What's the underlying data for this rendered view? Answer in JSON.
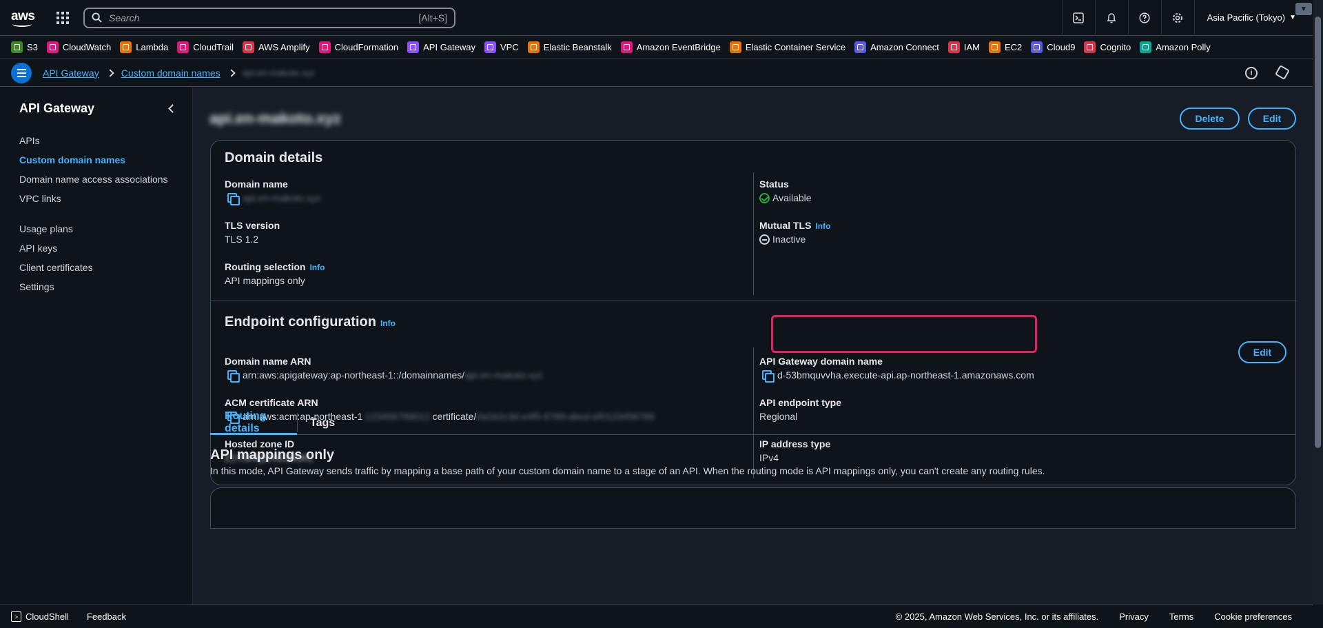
{
  "topnav": {
    "logo": "aws",
    "search_placeholder": "Search",
    "search_hint": "[Alt+S]",
    "region": "Asia Pacific (Tokyo)",
    "icons": [
      "cloudshell-icon",
      "bell-icon",
      "help-icon",
      "gear-icon"
    ]
  },
  "favorites": [
    {
      "label": "S3",
      "color": "#3f8624"
    },
    {
      "label": "CloudWatch",
      "color": "#e7157b"
    },
    {
      "label": "Lambda",
      "color": "#ed7100"
    },
    {
      "label": "CloudTrail",
      "color": "#e7157b"
    },
    {
      "label": "AWS Amplify",
      "color": "#dd344c"
    },
    {
      "label": "CloudFormation",
      "color": "#e7157b"
    },
    {
      "label": "API Gateway",
      "color": "#8c4fff"
    },
    {
      "label": "VPC",
      "color": "#8c4fff"
    },
    {
      "label": "Elastic Beanstalk",
      "color": "#ed7100"
    },
    {
      "label": "Amazon EventBridge",
      "color": "#e7157b"
    },
    {
      "label": "Elastic Container Service",
      "color": "#ed7100"
    },
    {
      "label": "Amazon Connect",
      "color": "#5a5ae6"
    },
    {
      "label": "IAM",
      "color": "#dd344c"
    },
    {
      "label": "EC2",
      "color": "#ed7100"
    },
    {
      "label": "Cloud9",
      "color": "#5a5ae6"
    },
    {
      "label": "Cognito",
      "color": "#dd344c"
    },
    {
      "label": "Amazon Polly",
      "color": "#01a88d"
    }
  ],
  "breadcrumb": {
    "items": [
      "API Gateway",
      "Custom domain names"
    ],
    "current": "api.en-makoto.xyz"
  },
  "sidebar": {
    "title": "API Gateway",
    "group1": [
      "APIs",
      "Custom domain names",
      "Domain name access associations",
      "VPC links"
    ],
    "group2": [
      "Usage plans",
      "API keys",
      "Client certificates",
      "Settings"
    ]
  },
  "page": {
    "title": "api.en-makoto.xyz",
    "delete_label": "Delete",
    "edit_label": "Edit"
  },
  "domain_details": {
    "title": "Domain details",
    "domain_name_label": "Domain name",
    "domain_name_value": "api.en-makoto.xyz",
    "tls_label": "TLS version",
    "tls_value": "TLS 1.2",
    "routing_label": "Routing selection",
    "routing_value": "API mappings only",
    "status_label": "Status",
    "status_value": "Available",
    "mtls_label": "Mutual TLS",
    "mtls_value": "Inactive",
    "info": "Info"
  },
  "endpoint": {
    "title": "Endpoint configuration",
    "info": "Info",
    "edit_label": "Edit",
    "arn_label": "Domain name ARN",
    "arn_value": "arn:aws:apigateway:ap-northeast-1::/domainnames/",
    "arn_hidden": "api.en-makoto.xyz",
    "acm_label": "ACM certificate ARN",
    "acm_value_prefix": "arn:aws:acm:ap-northeast-1",
    "acm_hidden_account": ":123456789012:",
    "acm_value_mid": "certificate/",
    "acm_hidden_id": "0a1b2c3d-e4f5-6789-abcd-ef0123456789",
    "zone_label": "Hosted zone ID",
    "zone_value": "Z1YSHQZHG15GKL",
    "gw_label": "API Gateway domain name",
    "gw_value": "d-53bmquvvha.execute-api.ap-northeast-1.amazonaws.com",
    "type_label": "API endpoint type",
    "type_value": "Regional",
    "ip_label": "IP address type",
    "ip_value": "IPv4"
  },
  "tabs": [
    "Routing details",
    "Tags"
  ],
  "mappings": {
    "title": "API mappings only",
    "text": "In this mode, API Gateway sends traffic by mapping a base path of your custom domain name to a stage of an API. When the routing mode is API mappings only, you can't create any routing rules."
  },
  "footer": {
    "cloudshell": "CloudShell",
    "feedback": "Feedback",
    "copyright": "© 2025, Amazon Web Services, Inc. or its affiliates.",
    "privacy": "Privacy",
    "terms": "Terms",
    "cookies": "Cookie preferences"
  }
}
